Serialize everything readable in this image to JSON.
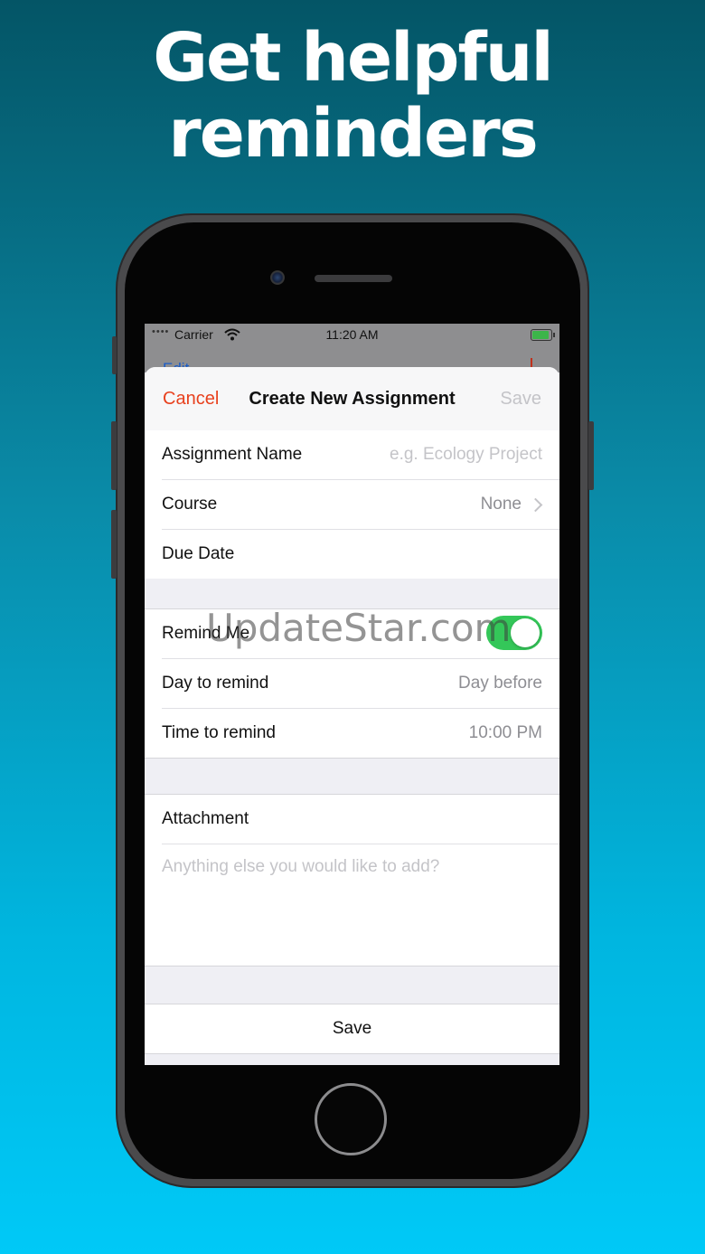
{
  "headline": {
    "line1": "Get helpful",
    "line2": "reminders"
  },
  "status_bar": {
    "dots": "••••",
    "carrier": "Carrier",
    "time": "11:20 AM",
    "wifi_icon": "wifi-icon",
    "battery_icon": "battery-charging-icon"
  },
  "background_nav": {
    "edit": "Edit"
  },
  "navbar": {
    "cancel": "Cancel",
    "title": "Create New Assignment",
    "save": "Save"
  },
  "details": {
    "assignment_name_label": "Assignment Name",
    "assignment_name_placeholder": "e.g. Ecology Project",
    "course_label": "Course",
    "course_value": "None",
    "due_date_label": "Due Date"
  },
  "reminder": {
    "remind_me_label": "Remind Me",
    "remind_me_on": true,
    "day_label": "Day to remind",
    "day_value": "Day before",
    "time_label": "Time to remind",
    "time_value": "10:00 PM"
  },
  "attachment": {
    "label": "Attachment",
    "notes_placeholder": "Anything else you would like to add?"
  },
  "footer": {
    "save": "Save"
  },
  "watermark": "UpdateStar.com",
  "colors": {
    "accent_cancel": "#e8411e",
    "toggle_on": "#34c759",
    "background_top": "#045566",
    "background_bottom": "#00c9f7"
  }
}
